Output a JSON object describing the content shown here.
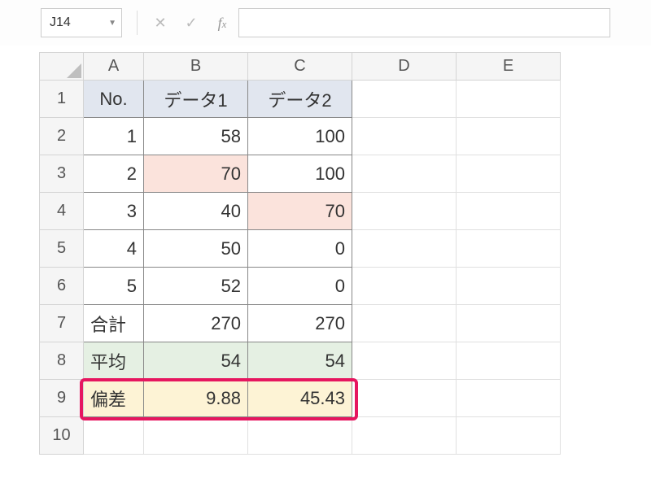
{
  "name_box": "J14",
  "formula_value": "",
  "columns": [
    "A",
    "B",
    "C",
    "D",
    "E"
  ],
  "rows": [
    "1",
    "2",
    "3",
    "4",
    "5",
    "6",
    "7",
    "8",
    "9",
    "10"
  ],
  "headers": {
    "no": "No.",
    "d1": "データ1",
    "d2": "データ2"
  },
  "data": [
    {
      "no": "1",
      "d1": "58",
      "d2": "100"
    },
    {
      "no": "2",
      "d1": "70",
      "d2": "100"
    },
    {
      "no": "3",
      "d1": "40",
      "d2": "70"
    },
    {
      "no": "4",
      "d1": "50",
      "d2": "0"
    },
    {
      "no": "5",
      "d1": "52",
      "d2": "0"
    }
  ],
  "summary": {
    "total_label": "合計",
    "total_d1": "270",
    "total_d2": "270",
    "avg_label": "平均",
    "avg_d1": "54",
    "avg_d2": "54",
    "dev_label": "偏差",
    "dev_d1": "9.88",
    "dev_d2": "45.43"
  },
  "chart_data": {
    "type": "table",
    "title": "",
    "columns": [
      "No.",
      "データ1",
      "データ2"
    ],
    "rows": [
      [
        1,
        58,
        100
      ],
      [
        2,
        70,
        100
      ],
      [
        3,
        40,
        70
      ],
      [
        4,
        50,
        0
      ],
      [
        5,
        52,
        0
      ]
    ],
    "aggregates": {
      "合計": [
        270,
        270
      ],
      "平均": [
        54,
        54
      ],
      "偏差": [
        9.88,
        45.43
      ]
    }
  }
}
